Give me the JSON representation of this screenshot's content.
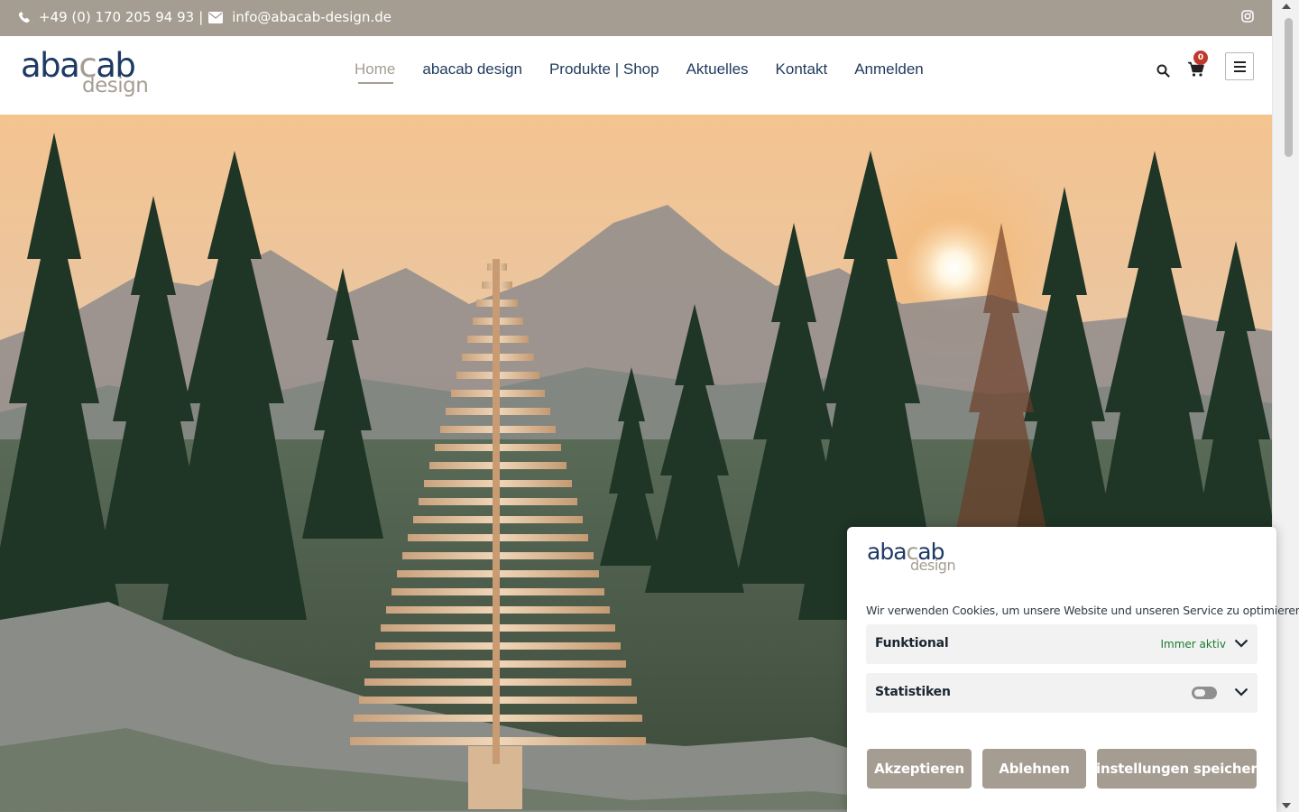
{
  "topbar": {
    "phone": "+49 (0) 170 205 94 93",
    "separator": "|",
    "email": "info@abacab-design.de",
    "icons": [
      "phone-icon",
      "envelope-icon",
      "instagram-icon"
    ]
  },
  "logo": {
    "word_a": "aba",
    "word_b": "c",
    "word_c": "ab",
    "sub": "design"
  },
  "nav": {
    "items": [
      {
        "label": "Home",
        "active": true
      },
      {
        "label": "abacab design"
      },
      {
        "label": "Produkte | Shop"
      },
      {
        "label": "Aktuelles"
      },
      {
        "label": "Kontakt"
      },
      {
        "label": "Anmelden"
      }
    ]
  },
  "header_actions": {
    "cart_count": "0",
    "icons": [
      "search-icon",
      "cart-icon",
      "hamburger-menu-icon"
    ]
  },
  "cookie": {
    "message": "Wir verwenden Cookies, um unsere Website und unseren Service zu optimieren.",
    "categories": [
      {
        "label": "Funktional",
        "status": "Immer aktiv"
      },
      {
        "label": "Statistiken",
        "enabled": false
      }
    ],
    "buttons": {
      "accept": "Akzeptieren",
      "decline": "Ablehnen",
      "save": "Einstellungen speichern"
    }
  },
  "colors": {
    "brand_taupe": "#a59d92",
    "brand_navy": "#1e3a64",
    "always_active_green": "#1c7a2d"
  }
}
